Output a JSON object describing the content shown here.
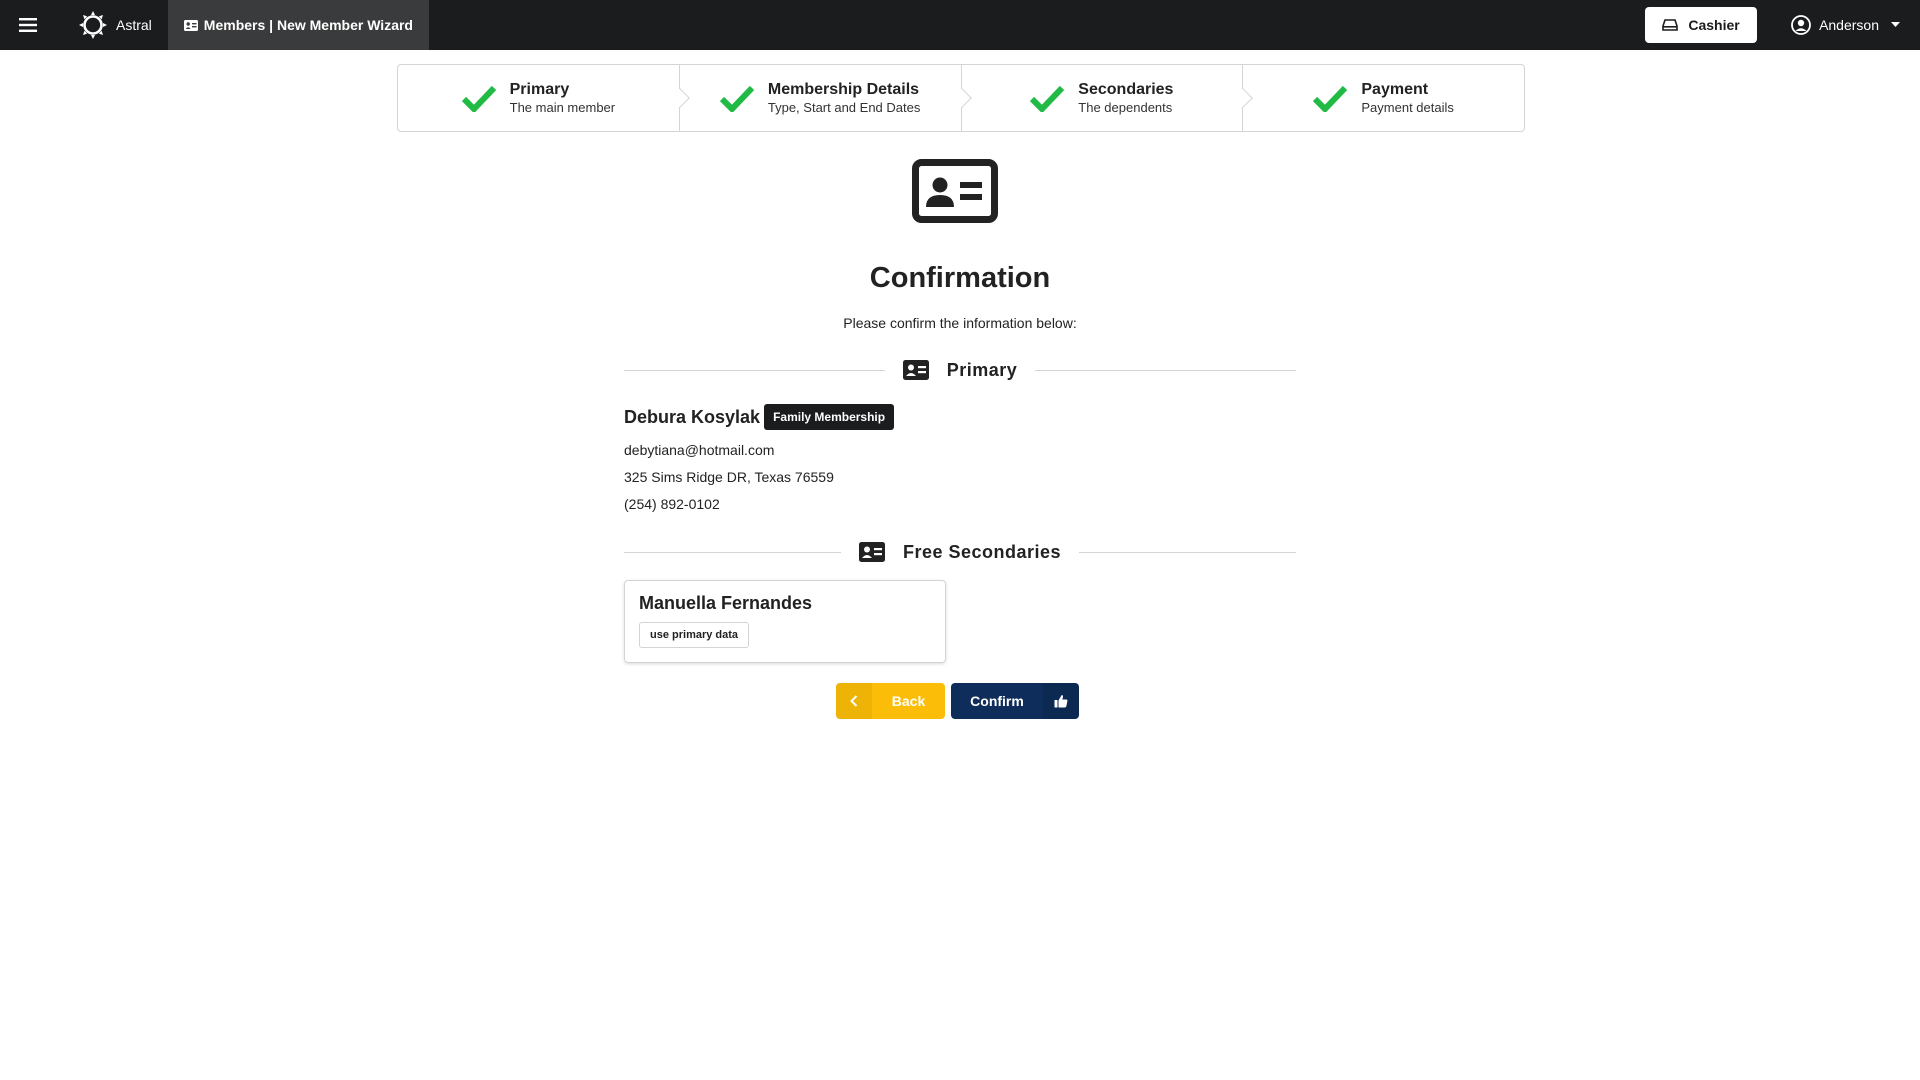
{
  "topbar": {
    "brand": "Astral",
    "breadcrumb": "Members | New Member Wizard",
    "cashier_label": "Cashier",
    "user_name": "Anderson"
  },
  "steps": [
    {
      "title": "Primary",
      "description": "The main member",
      "status": "completed"
    },
    {
      "title": "Membership Details",
      "description": "Type, Start and End Dates",
      "status": "completed"
    },
    {
      "title": "Secondaries",
      "description": "The dependents",
      "status": "completed"
    },
    {
      "title": "Payment",
      "description": "Payment details",
      "status": "completed"
    }
  ],
  "main": {
    "heading": "Confirmation",
    "subtext": "Please confirm the information below:",
    "primary_section_label": "Primary",
    "primary": {
      "name": "Debura Kosylak",
      "membership_badge": "Family Membership",
      "email": "debytiana@hotmail.com",
      "address": "325 Sims Ridge DR, Texas 76559",
      "phone": "(254) 892-0102"
    },
    "secondaries_section_label": "Free Secondaries",
    "secondaries": [
      {
        "name": "Manuella Fernandes",
        "tag": "use primary data"
      }
    ],
    "back_label": "Back",
    "confirm_label": "Confirm"
  },
  "colors": {
    "topbar": "#1b1c1d",
    "check": "#21ba45",
    "back_button": "#fbbd08",
    "confirm_button": "#0e2d5a"
  },
  "icons": {
    "menu": "hamburger-icon",
    "brand": "sun-gear-icon",
    "cashier": "cash-register-icon",
    "user": "user-circle-icon",
    "step": "checkmark-icon",
    "section": "id-card-icon",
    "back": "chevron-left-icon",
    "confirm": "thumbs-up-icon"
  }
}
